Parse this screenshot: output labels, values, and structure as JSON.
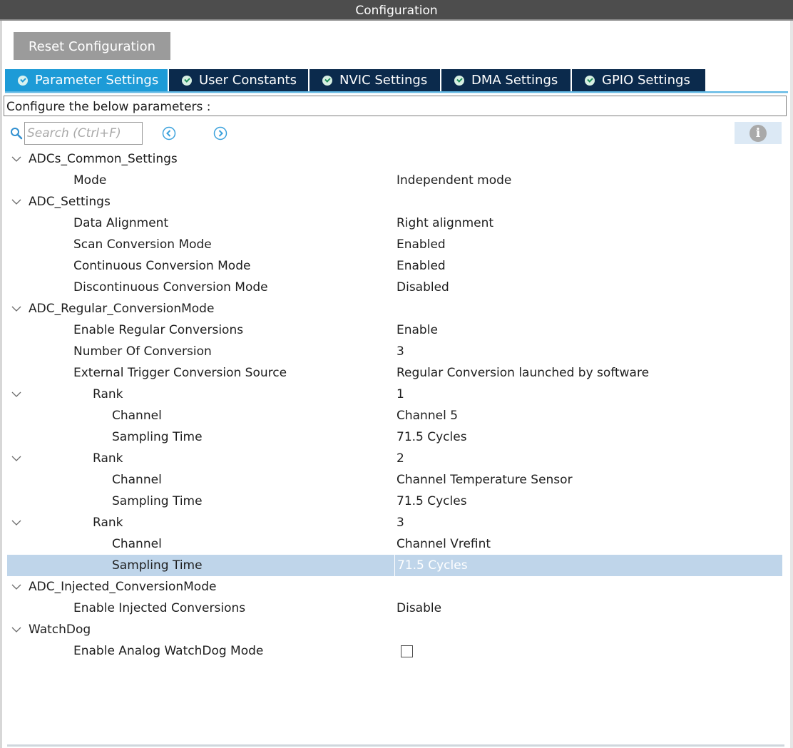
{
  "window": {
    "title": "Configuration"
  },
  "toolbar": {
    "reset_label": "Reset Configuration"
  },
  "tabs": [
    {
      "label": "Parameter Settings",
      "active": true
    },
    {
      "label": "User Constants",
      "active": false
    },
    {
      "label": "NVIC Settings",
      "active": false
    },
    {
      "label": "DMA Settings",
      "active": false
    },
    {
      "label": "GPIO Settings",
      "active": false
    }
  ],
  "description": "Configure the below parameters :",
  "search": {
    "placeholder": "Search (Ctrl+F)",
    "value": ""
  },
  "icons": {
    "search": "search-icon",
    "prev": "arrow-left-circle-icon",
    "next": "arrow-right-circle-icon",
    "info": "info-icon",
    "expand": "chevron-down-icon",
    "tab_status": "check-circle-icon"
  },
  "colors": {
    "title_bar": "#4d4d4d",
    "tab_active": "#1d9bd7",
    "tab_inactive": "#0b2a4c",
    "selection": "#bfd5ea",
    "reset_button": "#9b9b9b"
  },
  "tree": {
    "adcs_common": {
      "label": "ADCs_Common_Settings",
      "mode": {
        "label": "Mode",
        "value": "Independent mode"
      }
    },
    "adc_settings": {
      "label": "ADC_Settings",
      "data_alignment": {
        "label": "Data Alignment",
        "value": "Right alignment"
      },
      "scan_mode": {
        "label": "Scan Conversion Mode",
        "value": "Enabled"
      },
      "continuous_mode": {
        "label": "Continuous Conversion Mode",
        "value": "Enabled"
      },
      "discontinuous_mode": {
        "label": "Discontinuous Conversion Mode",
        "value": "Disabled"
      }
    },
    "regular": {
      "label": "ADC_Regular_ConversionMode",
      "enable_regular": {
        "label": "Enable Regular Conversions",
        "value": "Enable"
      },
      "num_conversion": {
        "label": "Number Of Conversion",
        "value": "3"
      },
      "ext_trigger": {
        "label": "External Trigger Conversion Source",
        "value": "Regular Conversion launched by software"
      },
      "ranks": [
        {
          "label": "Rank",
          "value": "1",
          "channel_label": "Channel",
          "channel": "Channel 5",
          "sampling_label": "Sampling Time",
          "sampling": "71.5 Cycles"
        },
        {
          "label": "Rank",
          "value": "2",
          "channel_label": "Channel",
          "channel": "Channel Temperature Sensor",
          "sampling_label": "Sampling Time",
          "sampling": "71.5 Cycles"
        },
        {
          "label": "Rank",
          "value": "3",
          "channel_label": "Channel",
          "channel": "Channel Vrefint",
          "sampling_label": "Sampling Time",
          "sampling": "71.5 Cycles"
        }
      ]
    },
    "injected": {
      "label": "ADC_Injected_ConversionMode",
      "enable_injected": {
        "label": "Enable Injected Conversions",
        "value": "Disable"
      }
    },
    "watchdog": {
      "label": "WatchDog",
      "enable_analog": {
        "label": "Enable Analog WatchDog Mode",
        "checked": false
      }
    }
  }
}
